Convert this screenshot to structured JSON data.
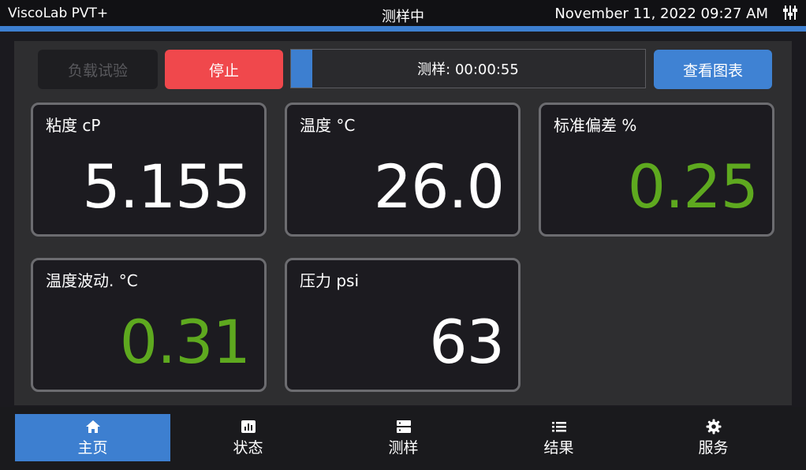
{
  "header": {
    "app_name": "ViscoLab PVT+",
    "mode": "测样中",
    "datetime": "November 11, 2022 09:27 AM",
    "menu_icon": "sliders-icon"
  },
  "colors": {
    "accent": "#3d7fd0",
    "stop": "#f0484c",
    "good_value": "#5ea91f",
    "card_border": "#6c6c70"
  },
  "controls": {
    "load_test_label": "负载试验",
    "stop_label": "停止",
    "view_chart_label": "查看图表",
    "progress_label": "测样: 00:00:55",
    "progress_fraction": 0.06
  },
  "readings": [
    {
      "title": "粘度  cP",
      "value": "5.155"
    },
    {
      "title": "温度  °C",
      "value": "26.0"
    },
    {
      "title": "标准偏差  %",
      "value": "0.25"
    },
    {
      "title": "温度波动. °C",
      "value": "0.31"
    },
    {
      "title": "压力  psi",
      "value": "63"
    }
  ],
  "nav": [
    {
      "label": "主页",
      "icon": "home-icon"
    },
    {
      "label": "状态",
      "icon": "bar-chart-icon"
    },
    {
      "label": "测样",
      "icon": "server-icon"
    },
    {
      "label": "结果",
      "icon": "list-icon"
    },
    {
      "label": "服务",
      "icon": "gear-icon"
    }
  ]
}
